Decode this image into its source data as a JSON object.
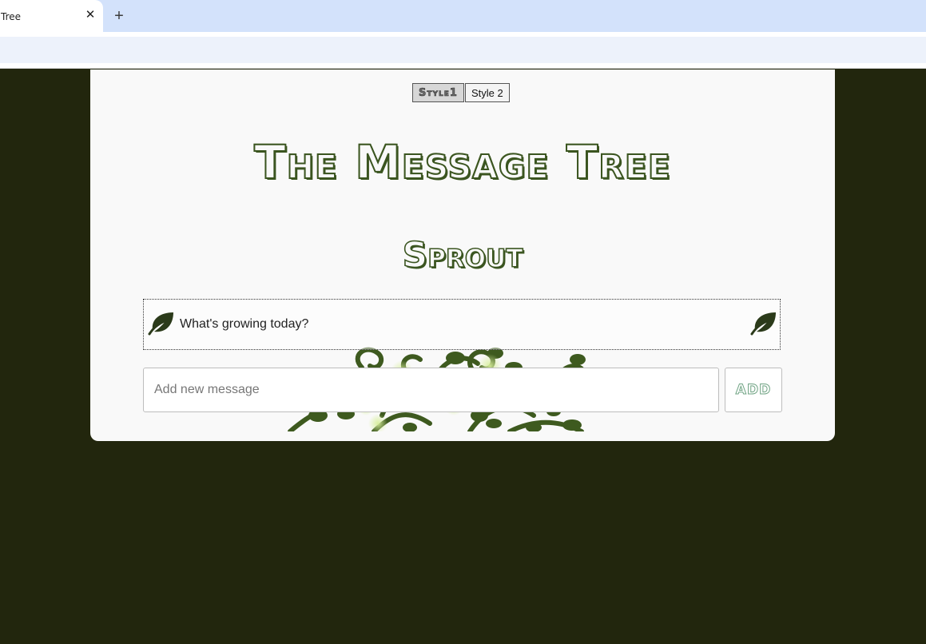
{
  "browser": {
    "tab_title": "Tree",
    "close_glyph": "✕",
    "new_tab_glyph": "+"
  },
  "style_switch": {
    "options": [
      "Style1",
      "Style 2"
    ],
    "active": "Style1"
  },
  "page": {
    "title": "The Message Tree",
    "subtitle": "Sprout"
  },
  "messages": [
    {
      "text": "What's growing today?",
      "icon": "leaf-icon"
    }
  ],
  "composer": {
    "placeholder": "Add new message",
    "value": "",
    "add_label": "ADD"
  },
  "colors": {
    "page_background": "#22260d",
    "card_background": "#f9f9f9",
    "accent_green": "#3b5520",
    "leaf_dark": "#2b3a1a",
    "add_outline": "#6fa383"
  }
}
